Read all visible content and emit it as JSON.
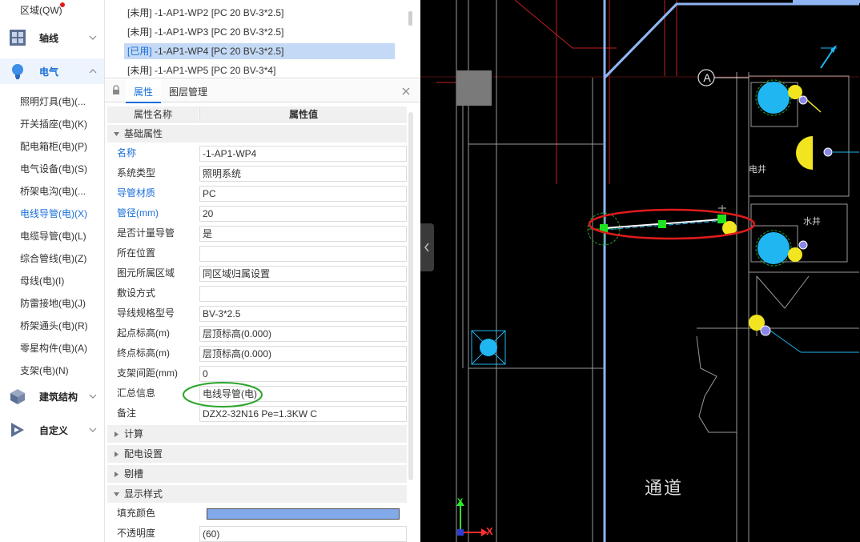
{
  "nav": {
    "top_item": "区域(QW)",
    "sections": [
      {
        "label": "轴线"
      },
      {
        "label": "电气"
      },
      {
        "label": "建筑结构"
      },
      {
        "label": "自定义"
      }
    ],
    "electrical_items": [
      "照明灯具(电)(...",
      "开关插座(电)(K)",
      "配电箱柜(电)(P)",
      "电气设备(电)(S)",
      "桥架电沟(电)(...",
      "电线导管(电)(X)",
      "电缆导管(电)(L)",
      "综合管线(电)(Z)",
      "母线(电)(I)",
      "防雷接地(电)(J)",
      "桥架通头(电)(R)",
      "零星构件(电)(A)",
      "支架(电)(N)"
    ],
    "active_item": "电线导管(电)(X)",
    "accent_color": "#1a6fd8"
  },
  "wire_list": [
    {
      "status": "[未用]",
      "text": " -1-AP1-WP2 [PC 20 BV-3*2.5]"
    },
    {
      "status": "[未用]",
      "text": " -1-AP1-WP3 [PC 20 BV-3*2.5]"
    },
    {
      "status": "[已用]",
      "text": " -1-AP1-WP4 [PC 20 BV-3*2.5]"
    },
    {
      "status": "[未用]",
      "text": " -1-AP1-WP5 [PC 20 BV-3*4]"
    }
  ],
  "tabs": {
    "properties": "属性",
    "layers": "图层管理"
  },
  "grid": {
    "col_name": "属性名称",
    "col_value": "属性值",
    "group_basic": "基础属性",
    "rows": [
      {
        "name": "名称",
        "value": "-1-AP1-WP4"
      },
      {
        "name": "系统类型",
        "value": "照明系统"
      },
      {
        "name": "导管材质",
        "value": "PC"
      },
      {
        "name": "管径(mm)",
        "value": "20"
      },
      {
        "name": "是否计量导管",
        "value": "是"
      },
      {
        "name": "所在位置",
        "value": ""
      },
      {
        "name": "图元所属区域",
        "value": "同区域归属设置"
      },
      {
        "name": "敷设方式",
        "value": ""
      },
      {
        "name": "导线规格型号",
        "value": "BV-3*2.5"
      },
      {
        "name": "起点标高(m)",
        "value": "层顶标高(0.000)"
      },
      {
        "name": "终点标高(m)",
        "value": "层顶标高(0.000)"
      },
      {
        "name": "支架间距(mm)",
        "value": "0"
      },
      {
        "name": "汇总信息",
        "value": "电线导管(电)"
      },
      {
        "name": "备注",
        "value": "DZX2-32N16 Pe=1.3KW C"
      }
    ],
    "groups_collapsed": [
      "计算",
      "配电设置",
      "剔槽"
    ],
    "group_display": "显示样式",
    "display_rows": [
      {
        "name": "填充颜色",
        "value": ""
      },
      {
        "name": "不透明度",
        "value": "(60)"
      }
    ],
    "fill_color": "#82aaea"
  },
  "cad": {
    "axis_a": "A",
    "shaft_elec": "电井",
    "shaft_water": "水井",
    "aisle": "通道",
    "ucs_x": "X",
    "ucs_y": "Y",
    "background": "#000000"
  }
}
